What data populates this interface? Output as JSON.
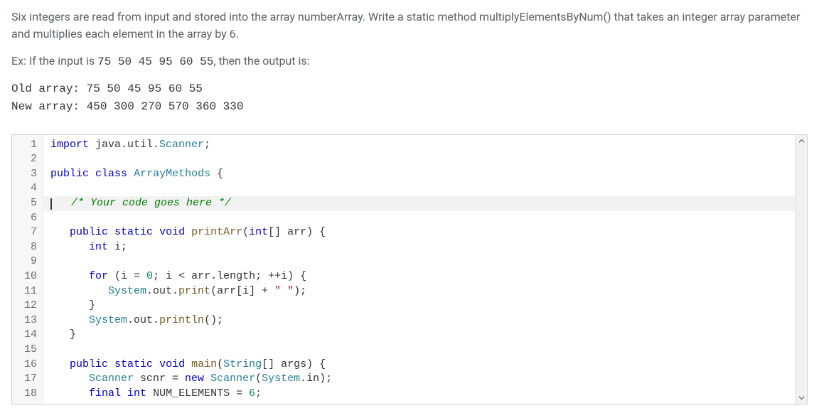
{
  "prompt": {
    "para1": "Six integers are read from input and stored into the array numberArray. Write a static method multiplyElementsByNum() that takes an integer array parameter and multiplies each element in the array by 6.",
    "ex_prefix": "Ex: If the input is ",
    "ex_input": "75 50 45 95 60 55",
    "ex_suffix": ", then the output is:"
  },
  "output": {
    "line1": "Old array: 75 50 45 95 60 55",
    "line2": "New array: 450 300 270 570 360 330"
  },
  "editor": {
    "active_line": 5,
    "lines": [
      {
        "n": 1,
        "tokens": [
          {
            "t": "import",
            "c": "tok-kw"
          },
          {
            "t": " java.util.",
            "c": ""
          },
          {
            "t": "Scanner",
            "c": "tok-type"
          },
          {
            "t": ";",
            "c": ""
          }
        ]
      },
      {
        "n": 2,
        "tokens": []
      },
      {
        "n": 3,
        "tokens": [
          {
            "t": "public",
            "c": "tok-kw"
          },
          {
            "t": " ",
            "c": ""
          },
          {
            "t": "class",
            "c": "tok-kw"
          },
          {
            "t": " ",
            "c": ""
          },
          {
            "t": "ArrayMethods",
            "c": "tok-class"
          },
          {
            "t": " {",
            "c": ""
          }
        ]
      },
      {
        "n": 4,
        "tokens": []
      },
      {
        "n": 5,
        "tokens": [
          {
            "t": "   ",
            "c": ""
          },
          {
            "t": "/* Your code goes here */",
            "c": "tok-comment"
          }
        ]
      },
      {
        "n": 6,
        "tokens": []
      },
      {
        "n": 7,
        "tokens": [
          {
            "t": "   ",
            "c": ""
          },
          {
            "t": "public",
            "c": "tok-kw"
          },
          {
            "t": " ",
            "c": ""
          },
          {
            "t": "static",
            "c": "tok-kw"
          },
          {
            "t": " ",
            "c": ""
          },
          {
            "t": "void",
            "c": "tok-kw"
          },
          {
            "t": " ",
            "c": ""
          },
          {
            "t": "printArr",
            "c": "tok-method"
          },
          {
            "t": "(",
            "c": ""
          },
          {
            "t": "int",
            "c": "tok-kw"
          },
          {
            "t": "[] arr) {",
            "c": ""
          }
        ]
      },
      {
        "n": 8,
        "tokens": [
          {
            "t": "      ",
            "c": ""
          },
          {
            "t": "int",
            "c": "tok-kw"
          },
          {
            "t": " i;",
            "c": ""
          }
        ]
      },
      {
        "n": 9,
        "tokens": []
      },
      {
        "n": 10,
        "tokens": [
          {
            "t": "      ",
            "c": ""
          },
          {
            "t": "for",
            "c": "tok-kw"
          },
          {
            "t": " (i = ",
            "c": ""
          },
          {
            "t": "0",
            "c": "tok-num"
          },
          {
            "t": "; i < arr.length; ++i) {",
            "c": ""
          }
        ]
      },
      {
        "n": 11,
        "tokens": [
          {
            "t": "         ",
            "c": ""
          },
          {
            "t": "System",
            "c": "tok-type"
          },
          {
            "t": ".out.",
            "c": ""
          },
          {
            "t": "print",
            "c": "tok-method"
          },
          {
            "t": "(arr[i] + ",
            "c": ""
          },
          {
            "t": "\" \"",
            "c": "tok-str"
          },
          {
            "t": ");",
            "c": ""
          }
        ]
      },
      {
        "n": 12,
        "tokens": [
          {
            "t": "      }",
            "c": ""
          }
        ]
      },
      {
        "n": 13,
        "tokens": [
          {
            "t": "      ",
            "c": ""
          },
          {
            "t": "System",
            "c": "tok-type"
          },
          {
            "t": ".out.",
            "c": ""
          },
          {
            "t": "println",
            "c": "tok-method"
          },
          {
            "t": "();",
            "c": ""
          }
        ]
      },
      {
        "n": 14,
        "tokens": [
          {
            "t": "   }",
            "c": ""
          }
        ]
      },
      {
        "n": 15,
        "tokens": []
      },
      {
        "n": 16,
        "tokens": [
          {
            "t": "   ",
            "c": ""
          },
          {
            "t": "public",
            "c": "tok-kw"
          },
          {
            "t": " ",
            "c": ""
          },
          {
            "t": "static",
            "c": "tok-kw"
          },
          {
            "t": " ",
            "c": ""
          },
          {
            "t": "void",
            "c": "tok-kw"
          },
          {
            "t": " ",
            "c": ""
          },
          {
            "t": "main",
            "c": "tok-method"
          },
          {
            "t": "(",
            "c": ""
          },
          {
            "t": "String",
            "c": "tok-type"
          },
          {
            "t": "[] args) {",
            "c": ""
          }
        ]
      },
      {
        "n": 17,
        "tokens": [
          {
            "t": "      ",
            "c": ""
          },
          {
            "t": "Scanner",
            "c": "tok-type"
          },
          {
            "t": " scnr = ",
            "c": ""
          },
          {
            "t": "new",
            "c": "tok-kw"
          },
          {
            "t": " ",
            "c": ""
          },
          {
            "t": "Scanner",
            "c": "tok-type"
          },
          {
            "t": "(",
            "c": ""
          },
          {
            "t": "System",
            "c": "tok-type"
          },
          {
            "t": ".in);",
            "c": ""
          }
        ]
      },
      {
        "n": 18,
        "tokens": [
          {
            "t": "      ",
            "c": ""
          },
          {
            "t": "final",
            "c": "tok-kw"
          },
          {
            "t": " ",
            "c": ""
          },
          {
            "t": "int",
            "c": "tok-kw"
          },
          {
            "t": " NUM_ELEMENTS = ",
            "c": ""
          },
          {
            "t": "6",
            "c": "tok-num"
          },
          {
            "t": ";",
            "c": ""
          }
        ]
      }
    ]
  }
}
